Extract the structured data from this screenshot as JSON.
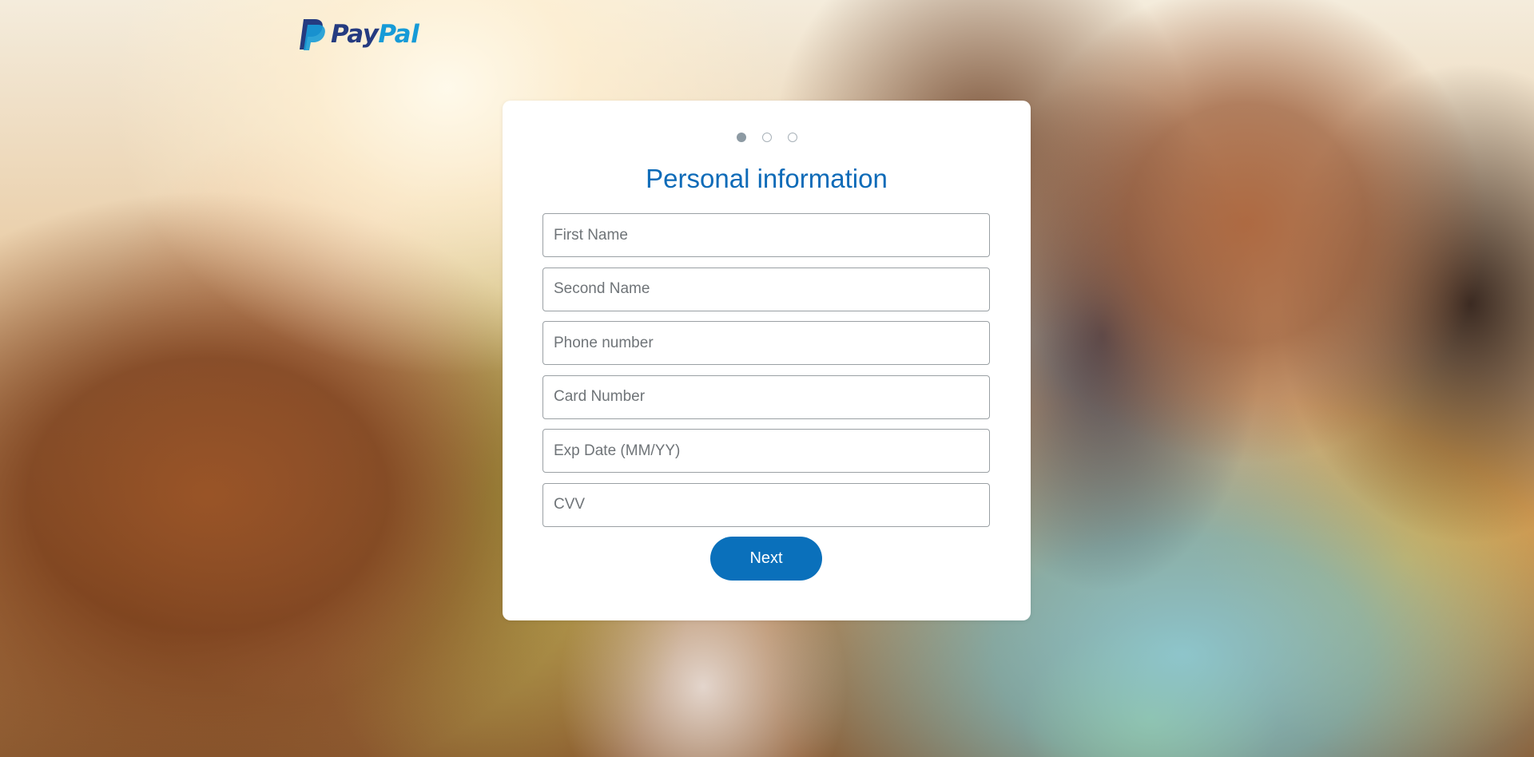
{
  "header": {
    "logo": {
      "icon": "paypal-logo-icon",
      "text_part1": "Pay",
      "text_part2": "Pal",
      "colors": {
        "dark_blue": "#253b80",
        "light_blue": "#179bd7"
      }
    }
  },
  "background": {
    "description_icon": "group-photo-background"
  },
  "card": {
    "steps": {
      "total": 3,
      "current": 1
    },
    "title": "Personal information",
    "title_color": "#0e6bb8",
    "fields": {
      "first_name": {
        "placeholder": "First Name",
        "value": ""
      },
      "second_name": {
        "placeholder": "Second Name",
        "value": ""
      },
      "phone_number": {
        "placeholder": "Phone number",
        "value": ""
      },
      "card_number": {
        "placeholder": "Card Number",
        "value": ""
      },
      "exp_date": {
        "placeholder": "Exp Date (MM/YY)",
        "value": ""
      },
      "cvv": {
        "placeholder": "CVV",
        "value": ""
      }
    },
    "next_button": {
      "label": "Next",
      "color": "#0a70bb"
    }
  }
}
